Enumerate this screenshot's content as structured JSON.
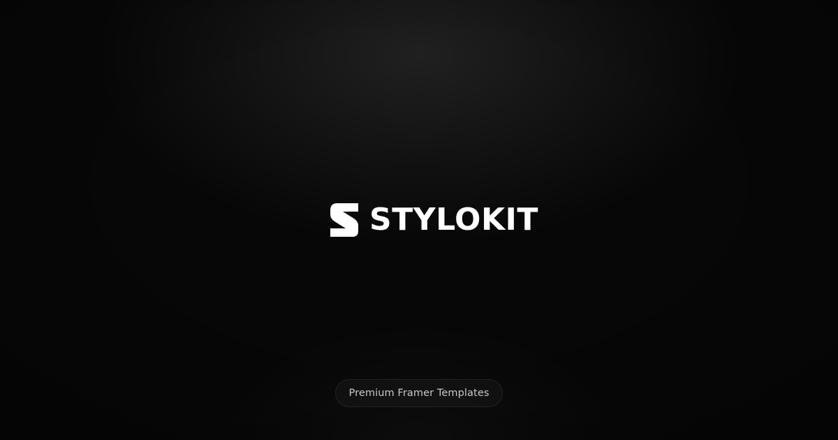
{
  "brand": {
    "name": "STYLOKIT",
    "logo_icon": "stylized-s-logo-icon",
    "color": "#ffffff"
  },
  "badge": {
    "label": "Premium Framer Templates"
  },
  "colors": {
    "background": "#070707",
    "text_muted": "#c9c9c9"
  }
}
